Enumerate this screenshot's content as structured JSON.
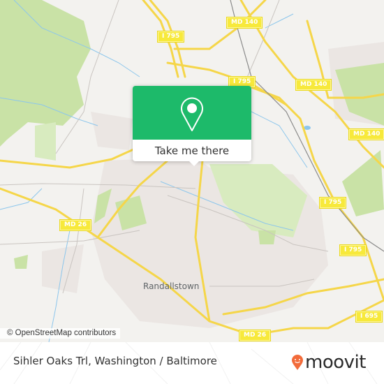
{
  "map": {
    "place_labels": [
      {
        "name": "Randallstown"
      }
    ],
    "road_shields": [
      {
        "label": "MD 140"
      },
      {
        "label": "I 795"
      },
      {
        "label": "I 795"
      },
      {
        "label": "MD 140"
      },
      {
        "label": "MD 140"
      },
      {
        "label": "I 795"
      },
      {
        "label": "I 795"
      },
      {
        "label": "MD 26"
      },
      {
        "label": "I 695"
      },
      {
        "label": "MD 26"
      }
    ],
    "attribution": "© OpenStreetMap contributors",
    "colors": {
      "background": "#f3f2ef",
      "park": "#c9e2a6",
      "residential": "#ebe6e3",
      "water": "#8cc6ec",
      "road": "#f7e07a",
      "road_major": "#f5d649"
    }
  },
  "popup": {
    "icon": "map-pin-icon",
    "action_label": "Take me there",
    "accent_color": "#1dba6a"
  },
  "footer": {
    "location_title": "Sihler Oaks Trl, Washington / Baltimore",
    "brand_name": "moovit",
    "brand_icon": "moovit-smiley-pin-icon",
    "brand_color": "#f26b3a"
  }
}
